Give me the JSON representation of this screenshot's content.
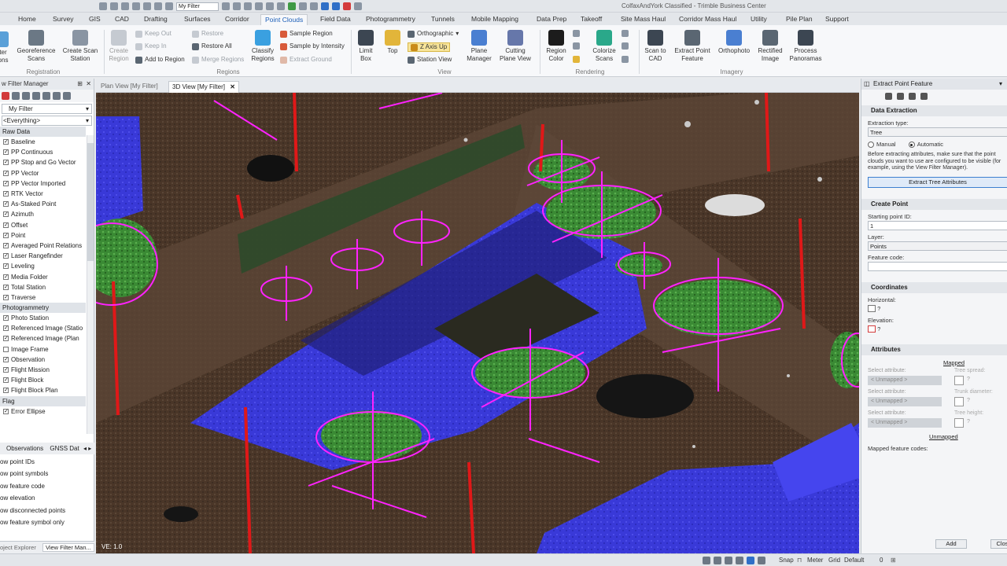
{
  "app": {
    "title": "ColfaxAndYork Classified - Trimble Business Center",
    "filter_value": "My Filter"
  },
  "ribbon_tabs": [
    "Home",
    "Survey",
    "GIS",
    "CAD",
    "Drafting",
    "Surfaces",
    "Corridor",
    "Point Clouds",
    "Field Data",
    "Photogrammetry",
    "Tunnels",
    "Mobile Mapping",
    "Data Prep",
    "Takeoff",
    "Site Mass Haul",
    "Corridor Mass Haul",
    "Utility",
    "Pile Plan",
    "Support"
  ],
  "active_tab": "Point Clouds",
  "ribbon": {
    "registration": {
      "filter_label": "ter\nons",
      "georef": "Georeference\nScans",
      "create_scan": "Create Scan\nStation",
      "group": "Registration"
    },
    "regions": {
      "create": "Create\nRegion",
      "keep_out": "Keep Out",
      "keep_in": "Keep In",
      "add_to_region": "Add to Region",
      "restore": "Restore",
      "restore_all": "Restore All",
      "merge_regions": "Merge Regions",
      "classify": "Classify\nRegions",
      "sample_region": "Sample Region",
      "sample_intensity": "Sample by Intensity",
      "extract_ground": "Extract Ground",
      "group": "Regions"
    },
    "view": {
      "limit_box": "Limit\nBox",
      "top": "Top",
      "orthographic": "Orthographic",
      "z_axis_up": "Z Axis Up",
      "station_view": "Station View",
      "plane_manager": "Plane\nManager",
      "cutting_plane": "Cutting\nPlane View",
      "group": "View"
    },
    "rendering": {
      "region_color": "Region\nColor",
      "colorize_scans": "Colorize\nScans",
      "group": "Rendering"
    },
    "imagery": {
      "scan_to_cad": "Scan to\nCAD",
      "extract_point_feature": "Extract Point\nFeature",
      "orthophoto": "Orthophoto",
      "rectified_image": "Rectified\nImage",
      "process_panoramas": "Process\nPanoramas",
      "group": "Imagery"
    }
  },
  "left_panel": {
    "title": "w Filter Manager",
    "filter": "My Filter",
    "scope": "<Everything>",
    "sections": [
      {
        "name": "Raw Data",
        "items": [
          {
            "label": "Baseline",
            "checked": true
          },
          {
            "label": "PP Continuous",
            "checked": true
          },
          {
            "label": "PP Stop and Go Vector",
            "checked": true
          },
          {
            "label": "PP Vector",
            "checked": true
          },
          {
            "label": "PP Vector Imported",
            "checked": true
          },
          {
            "label": "RTK Vector",
            "checked": true
          },
          {
            "label": "As-Staked Point",
            "checked": true
          },
          {
            "label": "Azimuth",
            "checked": true
          },
          {
            "label": "Offset",
            "checked": true
          },
          {
            "label": "Point",
            "checked": true
          },
          {
            "label": "Averaged Point Relations",
            "checked": true
          },
          {
            "label": "Laser Rangefinder",
            "checked": true
          },
          {
            "label": "Leveling",
            "checked": true
          },
          {
            "label": "Media Folder",
            "checked": true
          },
          {
            "label": "Total Station",
            "checked": true
          },
          {
            "label": "Traverse",
            "checked": true
          }
        ]
      },
      {
        "name": "Photogrammetry",
        "items": [
          {
            "label": "Photo Station",
            "checked": true
          },
          {
            "label": "Referenced Image (Statio",
            "checked": true
          },
          {
            "label": "Referenced Image (Plan",
            "checked": true
          },
          {
            "label": "Image Frame",
            "checked": false
          },
          {
            "label": "Observation",
            "checked": true
          },
          {
            "label": "Flight Mission",
            "checked": true
          },
          {
            "label": "Flight Block",
            "checked": true
          },
          {
            "label": "Flight Block Plan",
            "checked": true
          }
        ]
      },
      {
        "name": "Flag",
        "items": [
          {
            "label": "Error Ellipse",
            "checked": true
          }
        ]
      }
    ],
    "subtabs": [
      "Observations",
      "GNSS Dat"
    ],
    "options": [
      "ow point IDs",
      "ow point symbols",
      "ow feature code",
      "ow elevation",
      "ow disconnected points",
      "ow feature symbol only"
    ],
    "bottom_tabs": [
      "oject Explorer",
      "View Filter Man..."
    ]
  },
  "doc_tabs": [
    {
      "label": "Plan View [My Filter]",
      "active": false
    },
    {
      "label": "3D View [My Filter]",
      "active": true
    }
  ],
  "viewport": {
    "label": "VE: 1.0"
  },
  "right_panel": {
    "title": "Extract Point Feature",
    "data_extraction": {
      "section": "Data Extraction",
      "type_label": "Extraction type:",
      "type_value": "Tree",
      "manual": "Manual",
      "automatic": "Automatic",
      "note": "Before extracting attributes, make sure that the point clouds you want to use are configured to be visible (for example, using the View Filter Manager).",
      "button": "Extract Tree Attributes"
    },
    "create_point": {
      "section": "Create Point",
      "start_label": "Starting point ID:",
      "start_value": "1",
      "layer_label": "Layer:",
      "layer_value": "Points",
      "code_label": "Feature code:",
      "code_value": ""
    },
    "coordinates": {
      "section": "Coordinates",
      "horizontal": "Horizontal:",
      "elevation": "Elevation:",
      "q": "?"
    },
    "attributes": {
      "section": "Attributes",
      "mapped": "Mapped",
      "rows": [
        {
          "label": "Select attribute:",
          "value": "< Unmapped >",
          "target": "Tree spread:"
        },
        {
          "label": "Select attribute:",
          "value": "< Unmapped >",
          "target": "Trunk diameter:"
        },
        {
          "label": "Select attribute:",
          "value": "< Unmapped >",
          "target": "Tree height:"
        }
      ],
      "unmapped": "Unmapped",
      "mapped_codes": "Mapped feature codes:"
    },
    "add": "Add",
    "close": "Clos"
  },
  "status": {
    "snap": "Snap",
    "units": "Meter",
    "grid": "Grid",
    "default": "Default",
    "count": "0"
  },
  "colors": {
    "accent": "#1d5fb8",
    "building": "#3434e0",
    "tree": "#3f9a3a",
    "ground": "#5a4030",
    "feature": "#ff22ff",
    "marker": "#e01818"
  }
}
